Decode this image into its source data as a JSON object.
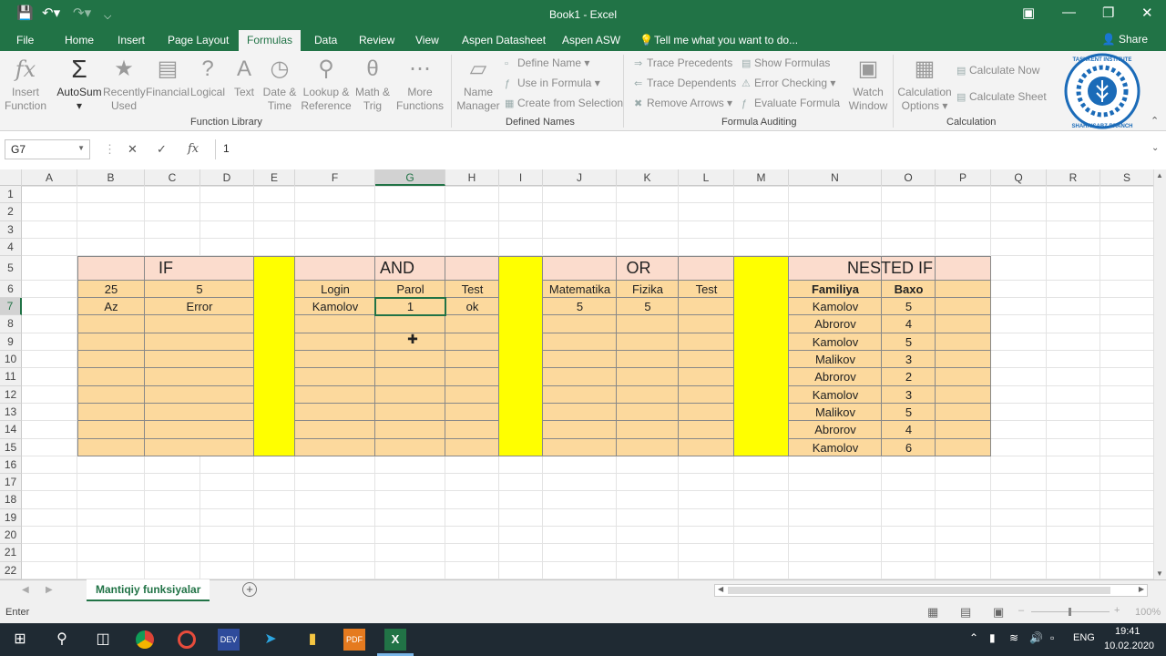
{
  "titlebar": {
    "title": "Book1  -  Excel",
    "undo_icon": "undo-icon",
    "redo_icon": "redo-icon",
    "save_icon": "save-icon"
  },
  "tabs": [
    "File",
    "Home",
    "Insert",
    "Page Layout",
    "Formulas",
    "Data",
    "Review",
    "View",
    "Aspen Datasheet",
    "Aspen ASW"
  ],
  "tell_me": "Tell me what you want to do...",
  "share": "Share",
  "ribbon": {
    "insert_function": [
      "Insert",
      "Function"
    ],
    "autosum": "AutoSum",
    "recently_used": [
      "Recently",
      "Used"
    ],
    "financial": "Financial",
    "logical": "Logical",
    "text": "Text",
    "date_time": [
      "Date &",
      "Time"
    ],
    "lookup": [
      "Lookup &",
      "Reference"
    ],
    "math": [
      "Math &",
      "Trig"
    ],
    "more": [
      "More",
      "Functions"
    ],
    "function_library": "Function Library",
    "name_manager": [
      "Name",
      "Manager"
    ],
    "define_name": "Define Name",
    "use_in_formula": "Use in Formula",
    "create_from_selection": "Create from Selection",
    "defined_names": "Defined Names",
    "trace_precedents": "Trace Precedents",
    "trace_dependents": "Trace Dependents",
    "remove_arrows": "Remove Arrows",
    "show_formulas": "Show Formulas",
    "error_checking": "Error Checking",
    "evaluate_formula": "Evaluate Formula",
    "formula_auditing": "Formula Auditing",
    "watch_window": [
      "Watch",
      "Window"
    ],
    "calc_options": [
      "Calculation",
      "Options"
    ],
    "calculate_now": "Calculate Now",
    "calculate_sheet": "Calculate Sheet",
    "calculation": "Calculation",
    "logo_text": "THE TASHKENT INSTITUTE OF CHEMICAL TECHNOLOGY",
    "logo_text_bottom": "SHAHRISABZ BRANCH"
  },
  "formula_bar": {
    "name_box": "G7",
    "fx": "fx",
    "value": "1"
  },
  "columns": [
    "A",
    "B",
    "C",
    "D",
    "E",
    "F",
    "G",
    "H",
    "I",
    "J",
    "K",
    "L",
    "M",
    "N",
    "O",
    "P",
    "Q",
    "R",
    "S"
  ],
  "rows": [
    "1",
    "2",
    "3",
    "4",
    "5",
    "6",
    "7",
    "8",
    "9",
    "10",
    "11",
    "12",
    "13",
    "14",
    "15",
    "16",
    "17",
    "18",
    "19",
    "20",
    "21",
    "22"
  ],
  "sheet": {
    "if": {
      "title": "IF",
      "b6": "25",
      "c6": "5",
      "b7": "Az",
      "c7": "Error"
    },
    "and": {
      "title": "AND",
      "headers": [
        "Login",
        "Parol",
        "Test"
      ],
      "row7": [
        "Kamolov",
        "1",
        "ok"
      ]
    },
    "or": {
      "title": "OR",
      "headers": [
        "Matematika",
        "Fizika",
        "Test"
      ],
      "row7": [
        "5",
        "5",
        ""
      ]
    },
    "nested": {
      "title": "NESTED IF",
      "headers": [
        "Familiya",
        "Baxo"
      ],
      "rows": [
        [
          "Kamolov",
          "5"
        ],
        [
          "Abrorov",
          "4"
        ],
        [
          "Kamolov",
          "5"
        ],
        [
          "Malikov",
          "3"
        ],
        [
          "Abrorov",
          "2"
        ],
        [
          "Kamolov",
          "3"
        ],
        [
          "Malikov",
          "5"
        ],
        [
          "Abrorov",
          "4"
        ],
        [
          "Kamolov",
          "6"
        ]
      ]
    }
  },
  "sheet_tab": "Mantiqiy funksiyalar",
  "status": {
    "mode": "Enter",
    "zoom": "100%"
  },
  "taskbar": {
    "lang": "ENG",
    "time": "19:41",
    "date": "10.02.2020"
  },
  "colors": {
    "excel_green": "#217346",
    "salmon": "#fbdccd",
    "orange": "#fcd99d",
    "yellow": "#ffff00"
  }
}
